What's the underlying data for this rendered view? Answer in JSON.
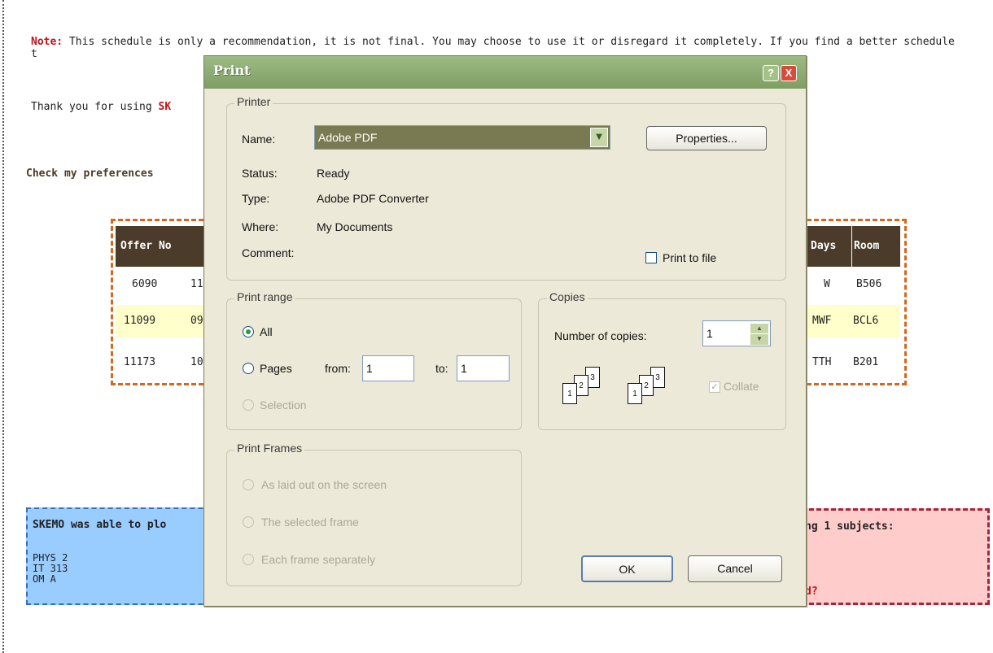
{
  "page": {
    "note_label": "Note:",
    "note_text": " This schedule is only a recommendation, it is not final. You may choose to use it or disregard it completely. If you find a better schedule t",
    "thanks_prefix": "Thank you for using ",
    "thanks_brand": "SK",
    "prefs_text": "Check my preferences",
    "table": {
      "headers": [
        "Offer No",
        "Days",
        "Room"
      ],
      "rows": [
        {
          "offer": "6090",
          "frag": "11",
          "days": "W",
          "room": "B506"
        },
        {
          "offer": "11099",
          "frag": "09",
          "days": "MWF",
          "room": "BCL6"
        },
        {
          "offer": "11173",
          "frag": "10",
          "days": "TTH",
          "room": "B201"
        }
      ]
    },
    "blue_box": {
      "title": "SKEMO was able to plo",
      "items": [
        "PHYS 2",
        "IT 313",
        "OM A"
      ]
    },
    "pink_box": {
      "title": "ng 1 subjects:",
      "footer": "d?"
    },
    "colors": {
      "accent_red": "#c0121a",
      "table_header": "#4b3b2a",
      "blue_box": "#99ccff",
      "pink_box": "#ffcccc",
      "dialog_title": "#8aaa6e"
    }
  },
  "dialog": {
    "title": "Print",
    "help_label": "?",
    "close_label": "X",
    "printer": {
      "legend": "Printer",
      "name_label": "Name:",
      "name_value": "Adobe PDF",
      "properties_label": "Properties...",
      "status_label": "Status:",
      "status_value": "Ready",
      "type_label": "Type:",
      "type_value": "Adobe PDF Converter",
      "where_label": "Where:",
      "where_value": "My Documents",
      "comment_label": "Comment:",
      "print_to_file_label": "Print to file"
    },
    "range": {
      "legend": "Print range",
      "all_label": "All",
      "pages_label": "Pages",
      "from_label": "from:",
      "from_value": "1",
      "to_label": "to:",
      "to_value": "1",
      "selection_label": "Selection"
    },
    "copies": {
      "legend": "Copies",
      "number_label": "Number of copies:",
      "number_value": "1",
      "collate_label": "Collate",
      "page_numbers": [
        "1",
        "2",
        "3"
      ]
    },
    "frames": {
      "legend": "Print Frames",
      "options": [
        "As laid out on the screen",
        "The selected frame",
        "Each frame separately"
      ]
    },
    "ok_label": "OK",
    "cancel_label": "Cancel"
  }
}
